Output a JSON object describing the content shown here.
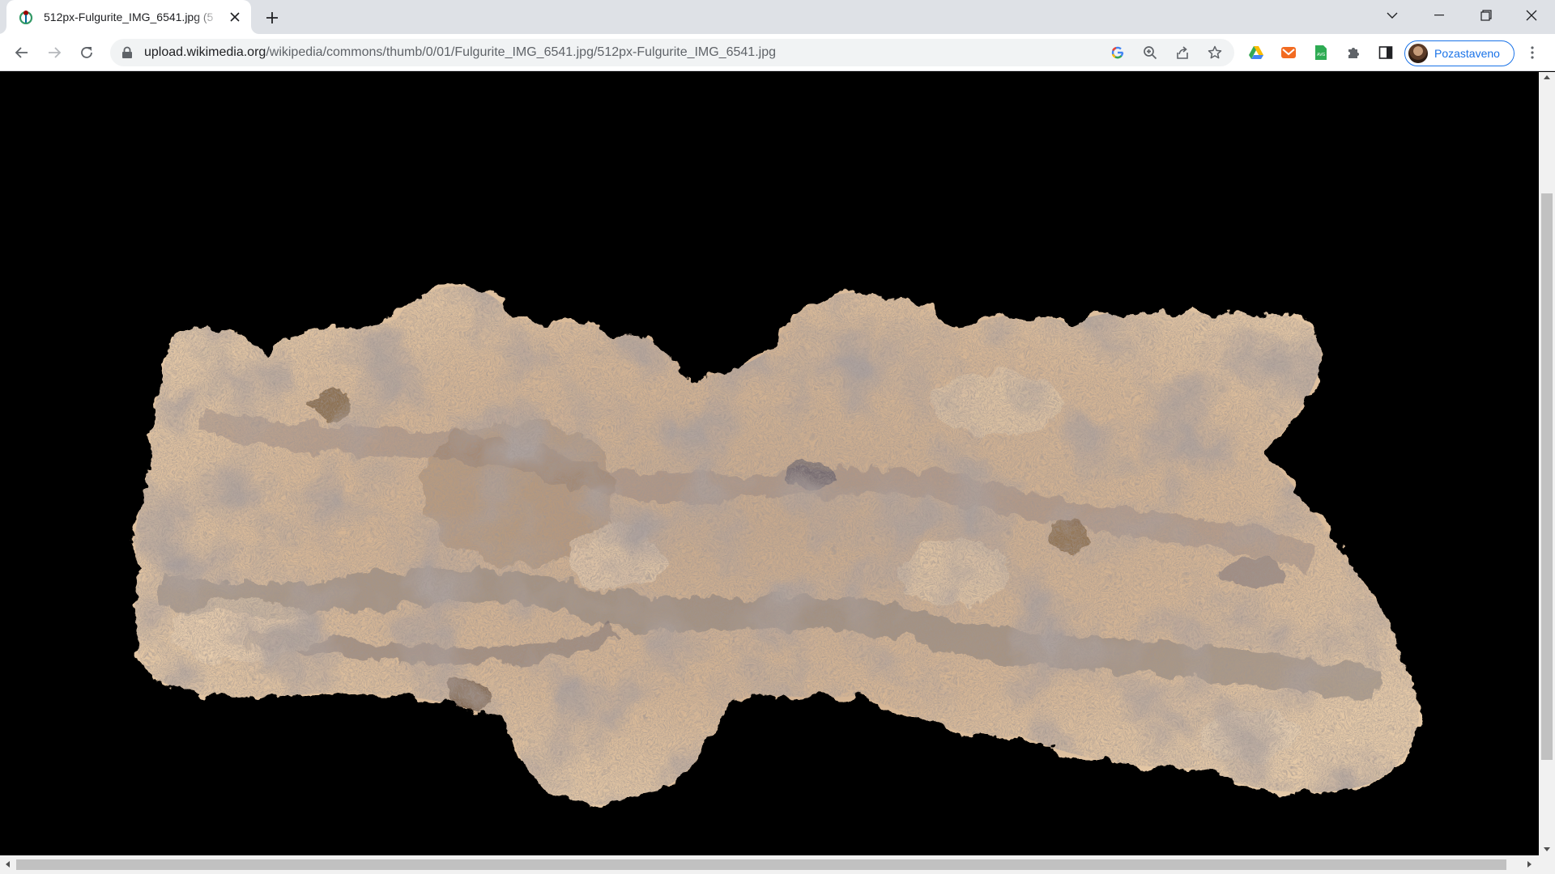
{
  "browser": {
    "tab": {
      "title": "512px-Fulgurite_IMG_6541.jpg (5",
      "favicon": "wikimedia-icon"
    },
    "address_bar": {
      "host": "upload.wikimedia.org",
      "path": "/wikipedia/commons/thumb/0/01/Fulgurite_IMG_6541.jpg/512px-Fulgurite_IMG_6541.jpg"
    },
    "profile": {
      "label": "Pozastaveno"
    }
  },
  "content": {
    "image_alt": "512px-Fulgurite_IMG_6541.jpg",
    "background": "#000000",
    "specimen_color": "#d8b894"
  },
  "icons": [
    "back-icon",
    "forward-icon",
    "reload-icon",
    "lock-icon",
    "google-lens-icon",
    "zoom-icon",
    "share-icon",
    "bookmark-star-icon",
    "google-drive-icon",
    "mail-extension-icon",
    "avg-extension-icon",
    "extensions-puzzle-icon",
    "side-panel-icon",
    "kebab-menu-icon"
  ]
}
